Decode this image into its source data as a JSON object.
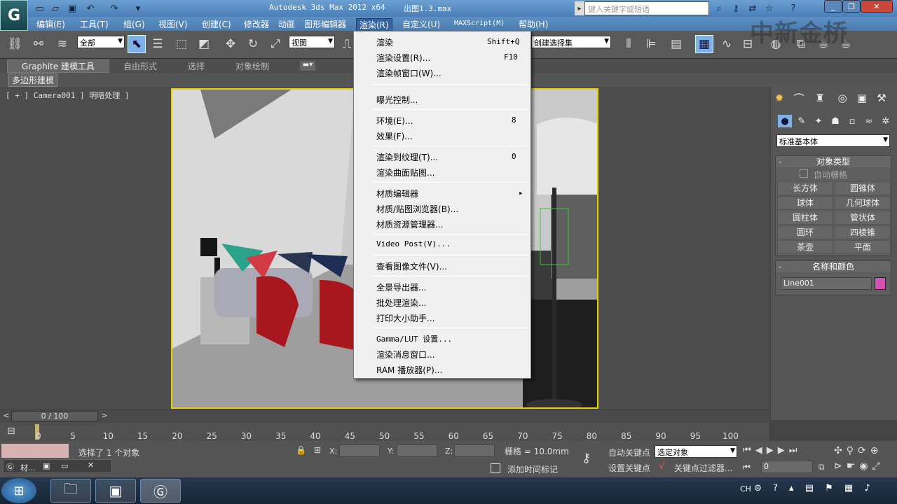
{
  "window": {
    "title": "Autodesk 3ds Max  2012 x64",
    "file": "出图1.3.max",
    "search_placeholder": "键入关键字或短语",
    "logo": "G"
  },
  "quick_access": [
    "new-icon",
    "open-icon",
    "save-icon",
    "undo-icon",
    "redo-icon",
    "dropdown-icon"
  ],
  "menubar": [
    "编辑(E)",
    "工具(T)",
    "组(G)",
    "视图(V)",
    "创建(C)",
    "修改器",
    "动画",
    "图形编辑器",
    "渲染(R)",
    "自定义(U)",
    "MAXScript(M)",
    "帮助(H)"
  ],
  "toolbar": {
    "filter_dropdown": "全部",
    "ref_coord_dropdown": "视图",
    "selection_set_dropdown": "创建选择集"
  },
  "ribbon": {
    "tabs": [
      "Graphite 建模工具",
      "自由形式",
      "选择",
      "对象绘制"
    ],
    "subtab": "多边形建模"
  },
  "viewport": {
    "label": "[ + ] Camera001 ] 明暗处理 ]"
  },
  "render_menu": {
    "items": [
      {
        "label": "渲染",
        "shortcut": "Shift+Q"
      },
      {
        "label": "渲染设置(R)...",
        "shortcut": "F10"
      },
      {
        "label": "渲染帧窗口(W)...",
        "shortcut": ""
      },
      {
        "label": "曝光控制...",
        "shortcut": ""
      },
      {
        "label": "环境(E)...",
        "shortcut": "8"
      },
      {
        "label": "效果(F)...",
        "shortcut": ""
      },
      {
        "label": "渲染到纹理(T)...",
        "shortcut": "0"
      },
      {
        "label": "渲染曲面贴图...",
        "shortcut": ""
      },
      {
        "label": "材质编辑器",
        "shortcut": "▸"
      },
      {
        "label": "材质/贴图浏览器(B)...",
        "shortcut": ""
      },
      {
        "label": "材质资源管理器...",
        "shortcut": ""
      },
      {
        "label": "Video Post(V)...",
        "shortcut": ""
      },
      {
        "label": "查看图像文件(V)...",
        "shortcut": ""
      },
      {
        "label": "全景导出器...",
        "shortcut": ""
      },
      {
        "label": "批处理渲染...",
        "shortcut": ""
      },
      {
        "label": "打印大小助手...",
        "shortcut": ""
      },
      {
        "label": "Gamma/LUT 设置...",
        "shortcut": ""
      },
      {
        "label": "渲染消息窗口...",
        "shortcut": ""
      },
      {
        "label": "RAM 播放器(P)...",
        "shortcut": ""
      }
    ]
  },
  "command_panel": {
    "category": "标准基本体",
    "object_type_title": "对象类型",
    "autogrid": "自动栅格",
    "buttons": [
      "长方体",
      "圆锥体",
      "球体",
      "几何球体",
      "圆柱体",
      "管状体",
      "圆环",
      "四棱锥",
      "茶壶",
      "平面"
    ],
    "name_color_title": "名称和颜色",
    "object_name": "Line001",
    "object_color": "#d64fb4"
  },
  "timeline": {
    "frame": "0 / 100",
    "ticks": [
      "0",
      "5",
      "10",
      "15",
      "20",
      "25",
      "30",
      "35",
      "40",
      "45",
      "50",
      "55",
      "60",
      "65",
      "70",
      "75",
      "80",
      "85",
      "90",
      "95",
      "100"
    ]
  },
  "status": {
    "message": "选择了 1 个对象",
    "x_label": "X:",
    "y_label": "Y:",
    "z_label": "Z:",
    "grid": "栅格 = 10.0mm",
    "add_time_tag": "添加时间标记",
    "auto_key": "自动关键点",
    "set_key": "设置关键点",
    "selected_dropdown": "选定对象",
    "key_filters": "关键点过滤器...",
    "frame_field": "0"
  },
  "mini_tab": {
    "label": "材..."
  },
  "taskbar": {
    "lang": "CH",
    "time": ""
  },
  "watermark": "中新金桥"
}
